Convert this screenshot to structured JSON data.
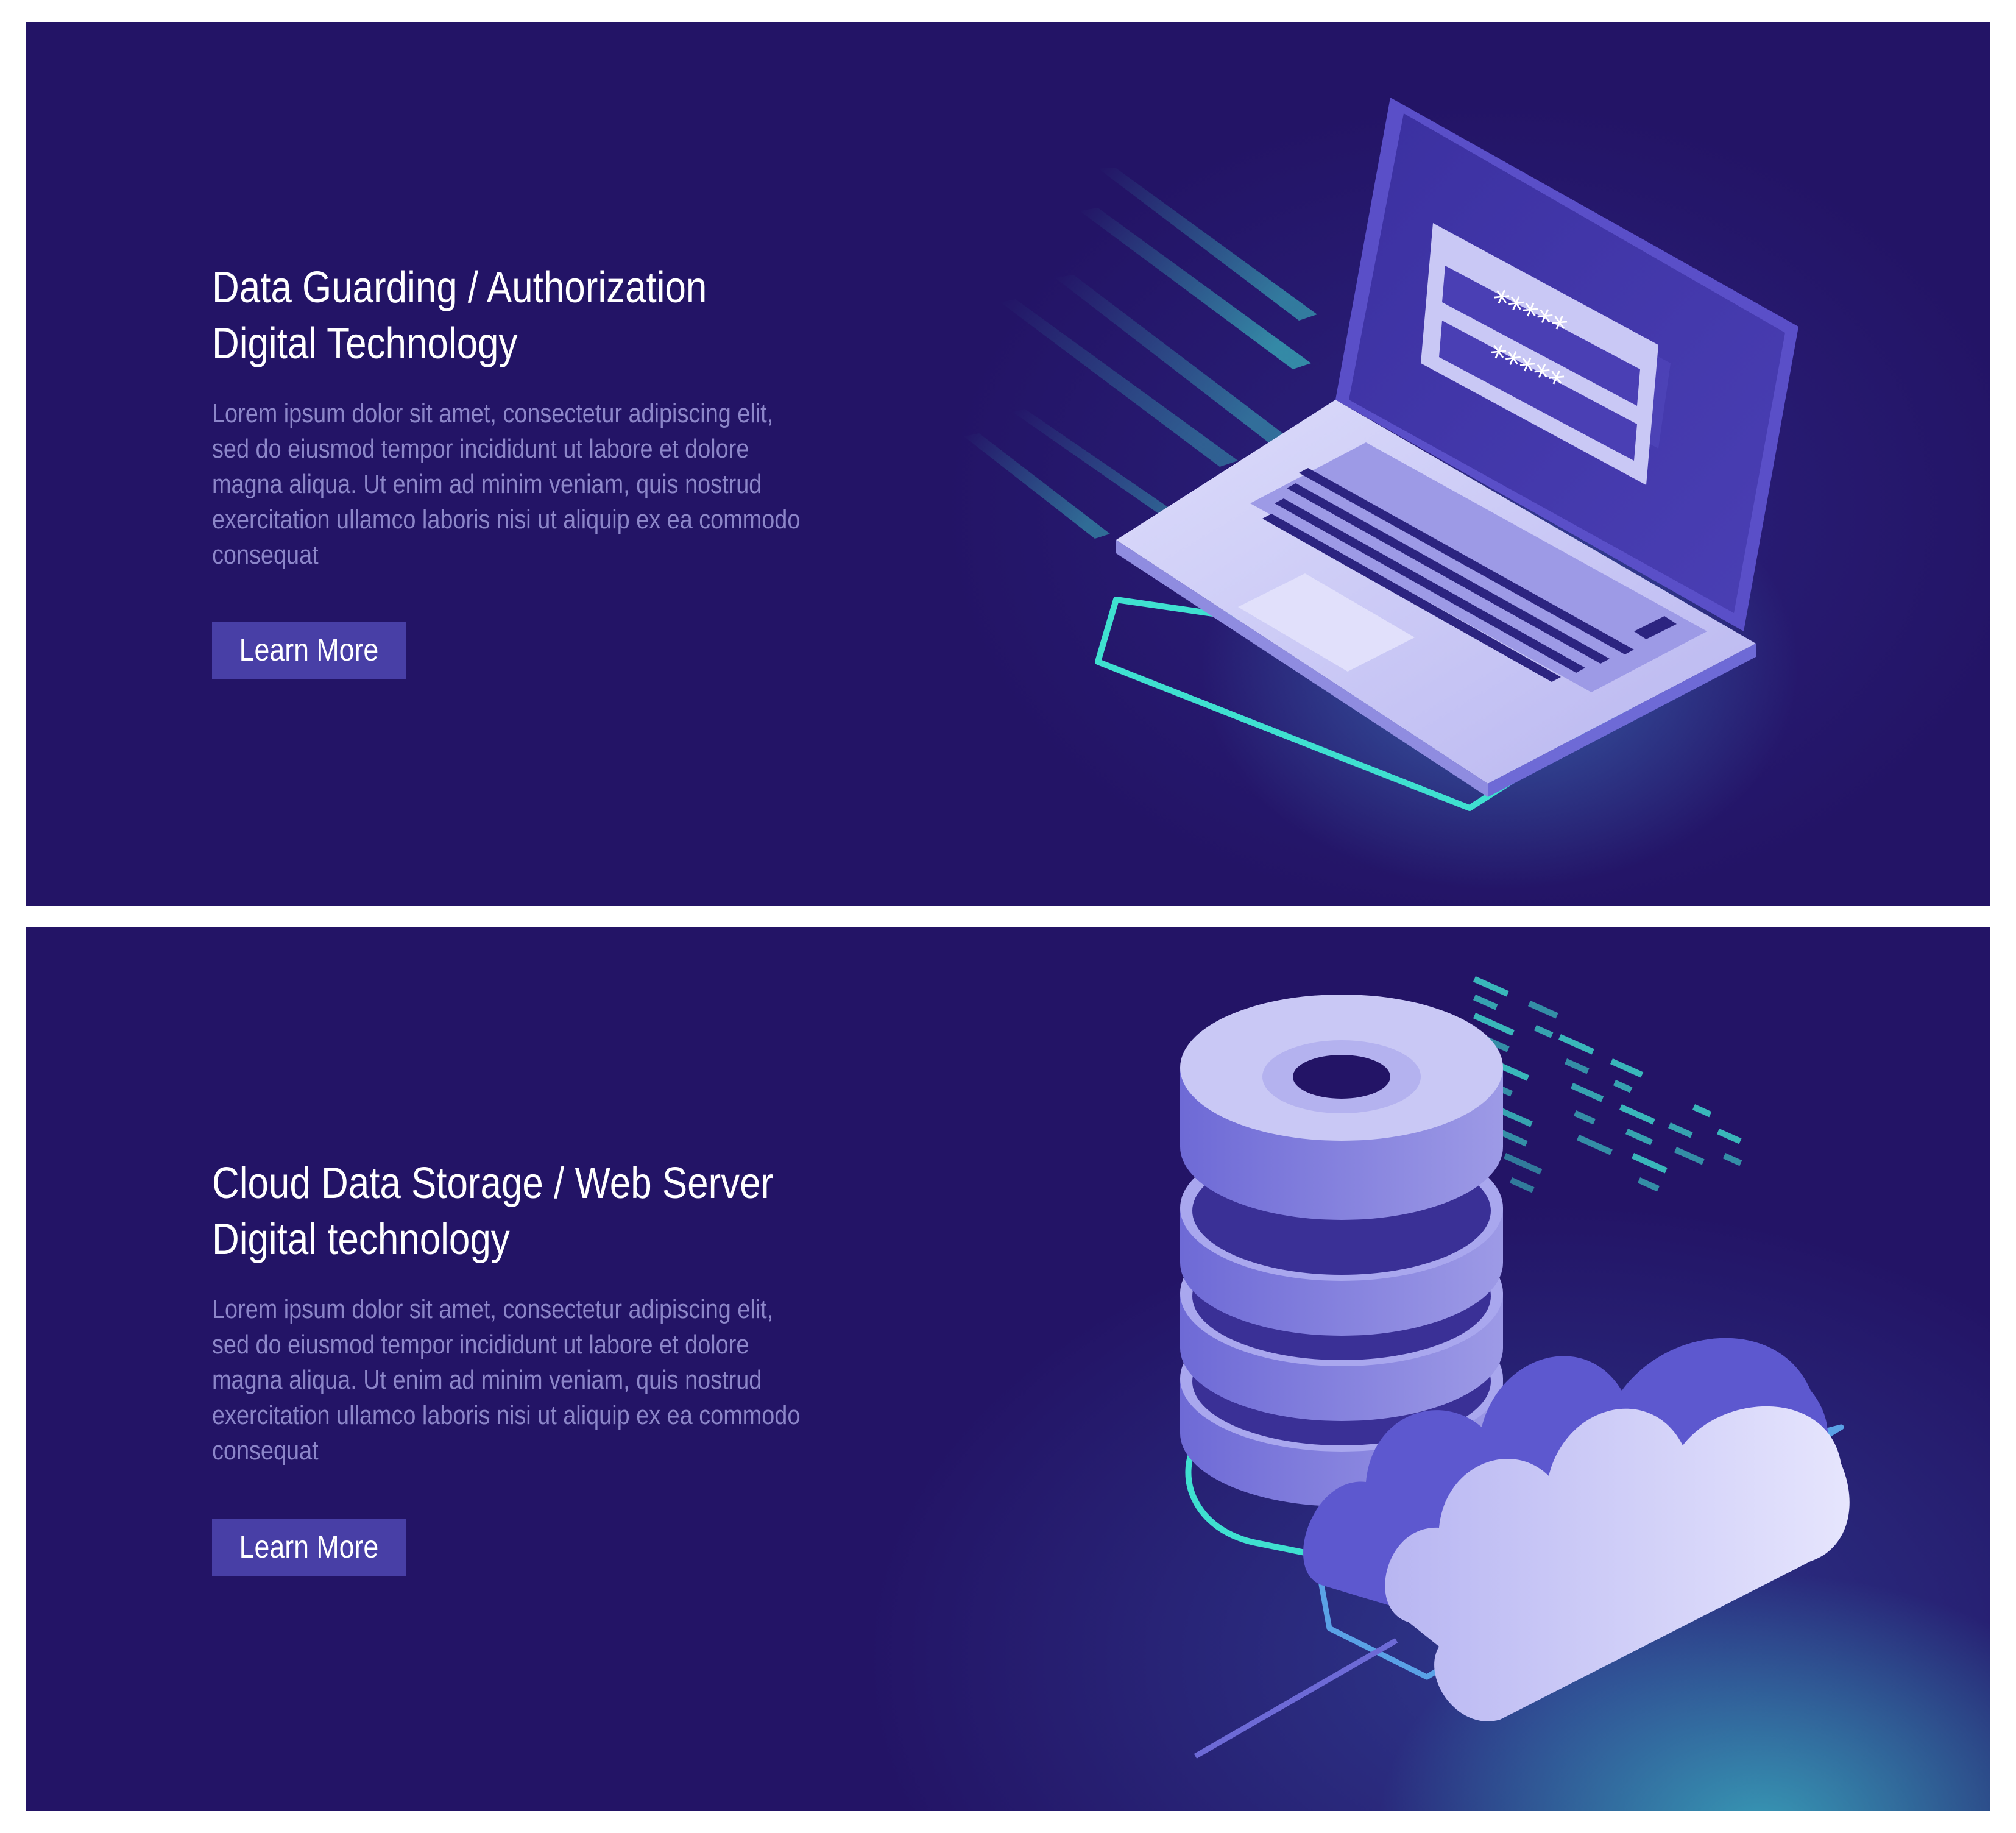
{
  "banners": [
    {
      "title_line1": "Data Guarding / Authorization",
      "title_line2": "Digital Technology",
      "description_lines": [
        "Lorem ipsum dolor sit amet, consectetur adipiscing elit,",
        "sed do eiusmod tempor incididunt ut labore et dolore",
        "magna aliqua. Ut enim ad minim veniam, quis nostrud",
        "exercitation ullamco laboris nisi ut aliquip ex ea commodo",
        "consequat"
      ],
      "button_label": "Learn More",
      "password_mask": "*****"
    },
    {
      "title_line1": "Cloud Data Storage / Web Server",
      "title_line2": "Digital technology",
      "description_lines": [
        "Lorem ipsum dolor sit amet, consectetur adipiscing elit,",
        "sed do eiusmod tempor incididunt ut labore et dolore",
        "magna aliqua. Ut enim ad minim veniam, quis nostrud",
        "exercitation ullamco laboris nisi ut aliquip ex ea commodo",
        "consequat"
      ],
      "button_label": "Learn More"
    }
  ],
  "colors": {
    "background": "#231466",
    "button": "#483fa6",
    "title": "#ffffff",
    "description": "#8c86c9",
    "accent_cyan": "#3fe0d0",
    "device_light": "#c9c8f5",
    "device_mid": "#6e6ad6"
  },
  "icons": [
    "laptop-icon",
    "password-field-icon",
    "database-server-icon",
    "cloud-icon",
    "data-stream-icon"
  ]
}
